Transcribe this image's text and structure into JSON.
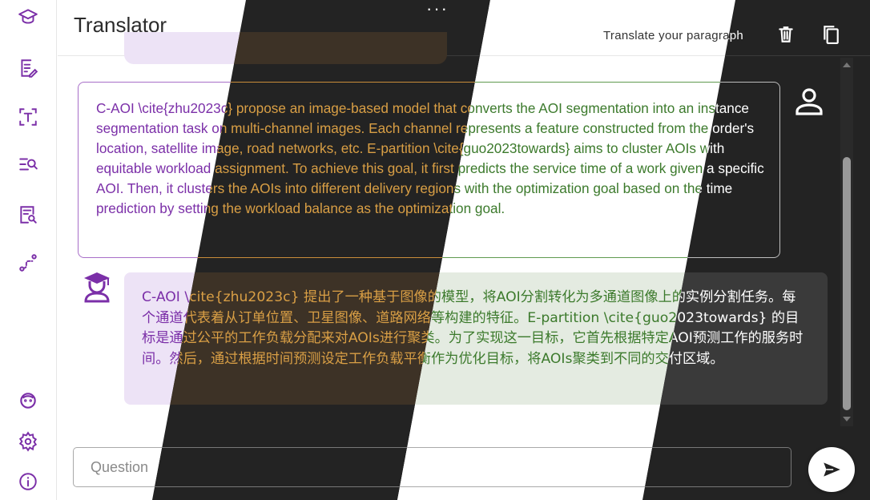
{
  "header": {
    "title": "Translator",
    "more_label": "···",
    "hint": "Translate your paragraph"
  },
  "sidebar": {
    "items": [
      {
        "icon": "graduation-cap-icon"
      },
      {
        "icon": "edit-document-icon"
      },
      {
        "icon": "text-scan-icon"
      },
      {
        "icon": "search-list-icon"
      },
      {
        "icon": "document-search-icon"
      },
      {
        "icon": "route-icon"
      }
    ],
    "bottom": [
      {
        "icon": "assistant-face-icon"
      },
      {
        "icon": "settings-icon"
      },
      {
        "icon": "info-icon"
      }
    ]
  },
  "toolbar": {
    "delete_icon": "trash-icon",
    "copy_icon": "copy-icon"
  },
  "messages": {
    "user_text": "C-AOI \\cite{zhu2023c} propose an image-based model that converts the AOI segmentation into an instance segmentation task on multi-channel images. Each channel represents a feature constructed from the order's location, satellite image, road networks, etc. E-partition \\cite{guo2023towards} aims to cluster AOIs with equitable workload assignment. To achieve this goal, it first predicts the service time of a work given a specific AOI. Then, it clusters the AOIs into different delivery regions with the optimization goal based on the time prediction by setting the workload balance as the optimization goal.",
    "bot_text": "C-AOI \\cite{zhu2023c} 提出了一种基于图像的模型，将AOI分割转化为多通道图像上的实例分割任务。每个通道代表着从订单位置、卫星图像、道路网络等构建的特征。E-partition \\cite{guo2023towards} 的目标是通过公平的工作负载分配来对AOIs进行聚类。为了实现这一目标，它首先根据特定AOI预测工作的服务时间。然后，通过根据时间预测设定工作负载平衡作为优化目标，将AOIs聚类到不同的交付区域。"
  },
  "input": {
    "placeholder": "Question"
  },
  "themes": {
    "light_purple": {
      "accent": "#7b2fa8"
    },
    "dark_amber": {
      "accent": "#d99f45"
    },
    "light_green": {
      "accent": "#3c7a2c"
    },
    "dark_white": {
      "accent": "#ffffff"
    }
  }
}
